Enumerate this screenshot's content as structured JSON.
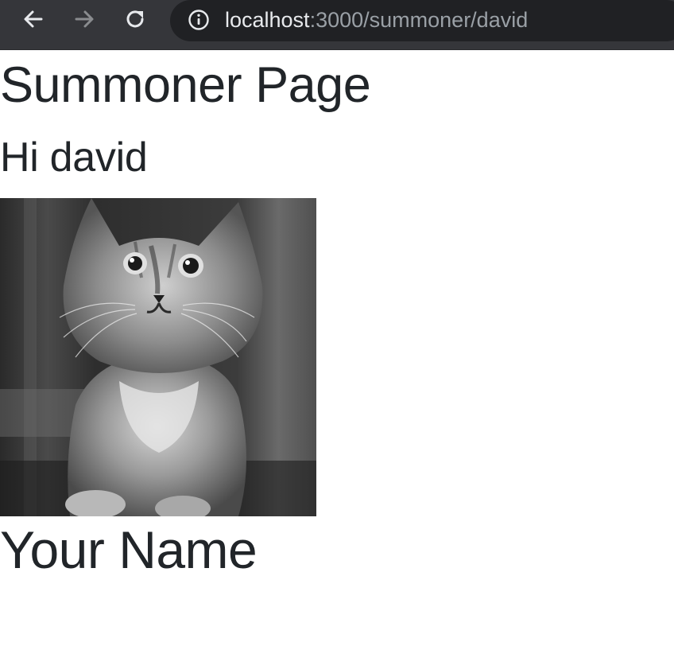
{
  "browser": {
    "nav": {
      "back_icon": "arrow-left-icon",
      "forward_icon": "arrow-right-icon",
      "reload_icon": "reload-icon"
    },
    "address_bar": {
      "info_icon": "info-icon",
      "host": "localhost",
      "path": ":3000/summoner/david"
    }
  },
  "page": {
    "title": "Summoner Page",
    "greeting": "Hi david",
    "image_subject": "kitten-photo",
    "subtitle": "Your Name"
  },
  "colors": {
    "toolbar_bg": "#35363a",
    "address_bg": "#202124",
    "url_host": "#e8eaed",
    "url_path": "#9aa0a6",
    "text": "#212529",
    "page_bg": "#ffffff"
  }
}
